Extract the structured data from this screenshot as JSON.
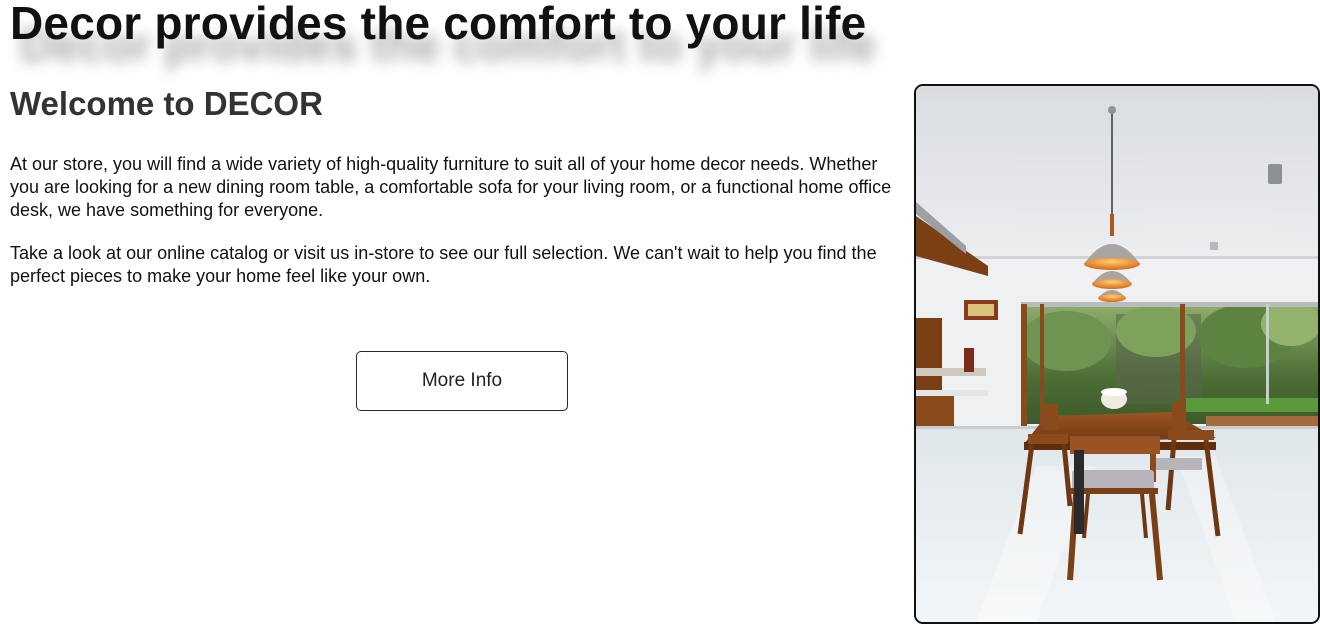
{
  "hero": {
    "headline": "Decor provides the comfort to your life"
  },
  "intro": {
    "title": "Welcome to DECOR",
    "paragraph_1": "At our store, you will find a wide variety of high-quality furniture to suit all of your home decor needs. Whether you are looking for a new dining room table, a comfortable sofa for your living room, or a functional home office desk, we have something for everyone.",
    "paragraph_2": "Take a look at our online catalog or visit us in-store to see our full selection. We can't wait to help you find the perfect pieces to make your home feel like your own.",
    "button_label": "More Info"
  },
  "photo": {
    "subject": "dining-room-interior",
    "colors": {
      "ceiling": "#e4e6ea",
      "wall": "#eef0f2",
      "floor": "#e6ecef",
      "wood": "#8a4a1c",
      "lamp_glow": "#e07a20",
      "garden": "#4f7a3a",
      "border": "#111111"
    }
  }
}
